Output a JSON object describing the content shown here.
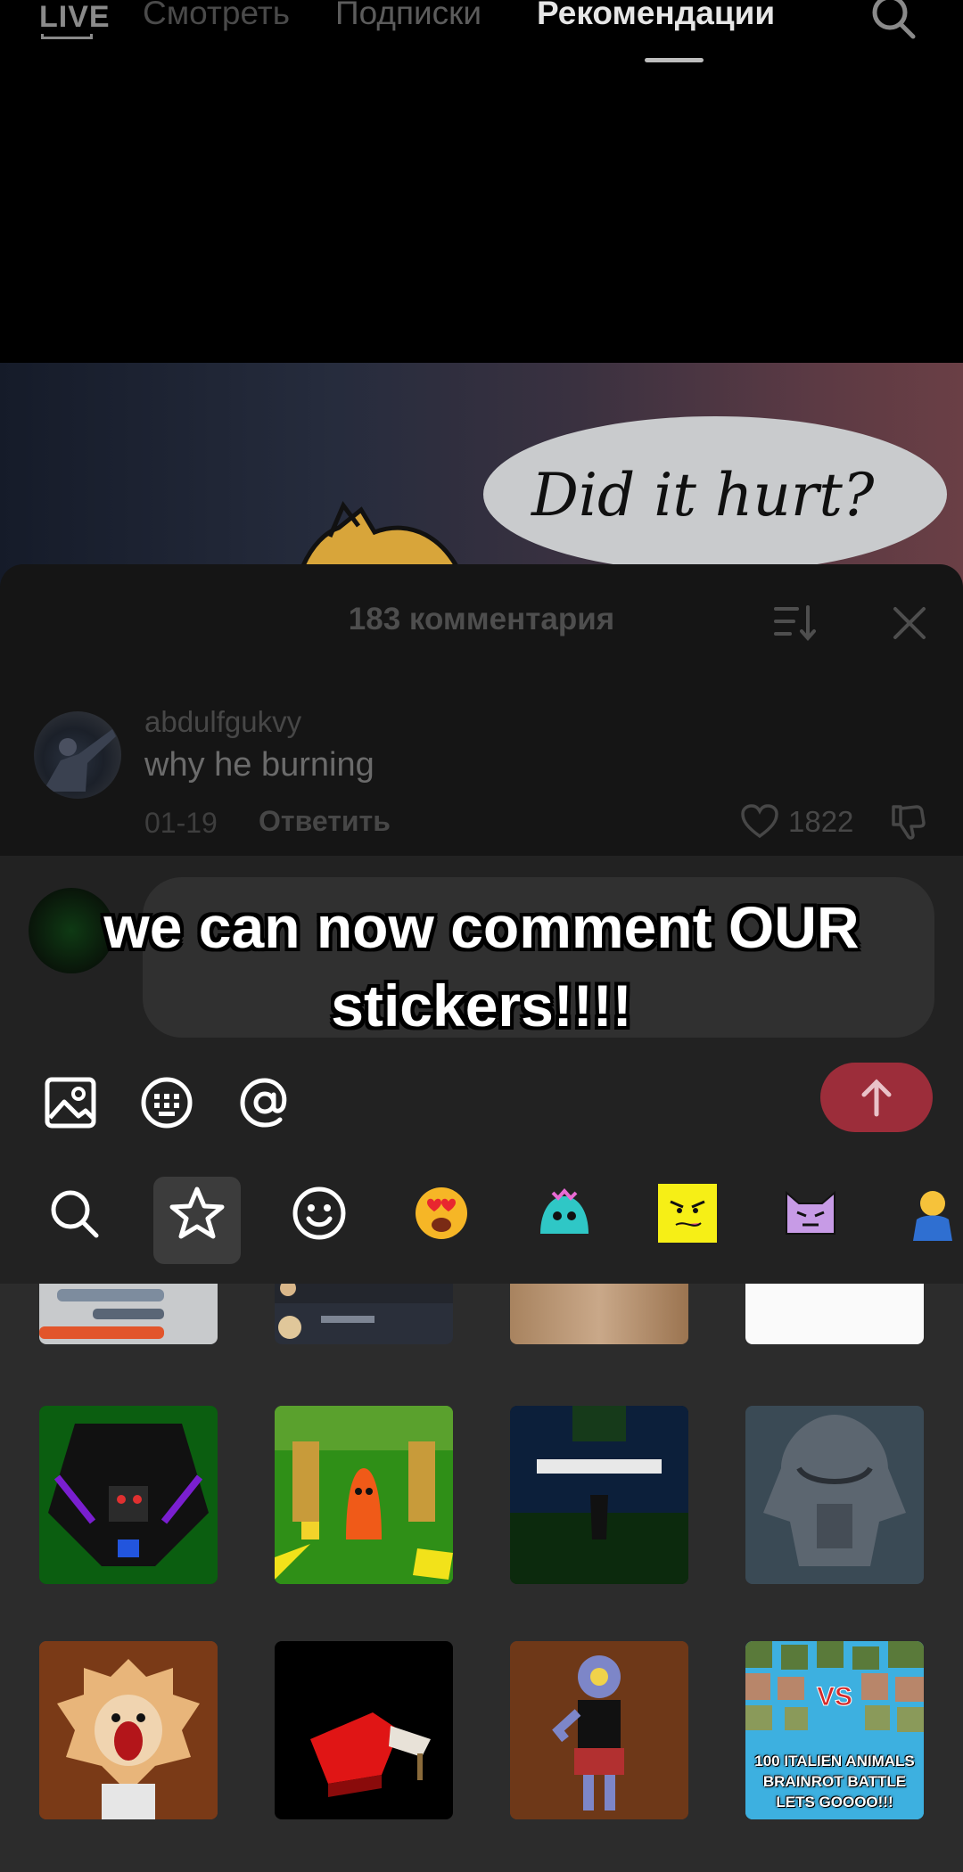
{
  "nav": {
    "live": "LIVE",
    "tabs": [
      "Смотреть",
      "Подписки",
      "Рекомендации"
    ]
  },
  "video": {
    "bubble_text": "Did it hurt?"
  },
  "comments": {
    "title": "183 комментария",
    "items": [
      {
        "user": "abdulfgukvy",
        "text": "why he burning",
        "date": "01-19",
        "reply": "Ответить",
        "likes": "1822"
      }
    ]
  },
  "caption": {
    "line1": "we can now comment OUR",
    "line2": "stickers!!!!"
  },
  "stickers": {
    "battle_label_lines": [
      "100 ITALIEN ANIMALS",
      "BRAINROT BATTLE",
      "LETS GOOOO!!!"
    ]
  },
  "colors": {
    "send_button": "#9c2d3a",
    "sheet_bg": "#151515",
    "grid_bg": "#2c2c2c"
  }
}
